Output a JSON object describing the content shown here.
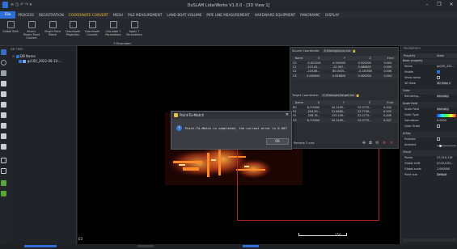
{
  "window": {
    "title": "DuSLAM LidarWorks V1.0.0 - [3D View 1]",
    "quick_access": "≡  ◫  ↶  ↷  ▾",
    "controls": [
      "–",
      "❐",
      "✕"
    ]
  },
  "menu": {
    "file": "File",
    "items": [
      "PROCESS",
      "REGISTRATION",
      "COORDINATE CONVERT",
      "MESH",
      "PILE MEASUREMENT",
      "LAND BOAT VOLUME",
      "PIPE LINE MEASUREMENT",
      "HARDWARE EQUIPMENT",
      "PANORAMIC",
      "DISPLAY"
    ],
    "active_index": 2
  },
  "ribbon": {
    "buttons": [
      {
        "label": "Global Shift",
        "icon": "global-shift-icon"
      },
      {
        "label": "Seven-Param Point Convert",
        "icon": "point-convert-icon"
      },
      {
        "label": "Single Point Match",
        "icon": "point-match-icon"
      },
      {
        "label": "Coordinate Projection",
        "icon": "projection-icon"
      },
      {
        "label": "Coordinate Convert",
        "icon": "coordinate-convert-icon"
      },
      {
        "label": "Calculate 7 Parameters",
        "icon": "calculate-icon"
      },
      {
        "label": "Apply 7 Parameters",
        "icon": "apply-icon"
      }
    ],
    "group_label": "7 Parameter"
  },
  "tree": {
    "header": "DB TREE",
    "rows": [
      {
        "label": "DB Name",
        "level": 0
      },
      {
        "label": "gs100_2022-08-10-...",
        "level": 1
      }
    ]
  },
  "source_panel": {
    "label": "Source Coordinate:",
    "path": "E:/Data/pts/src.txt",
    "columns": [
      "Name",
      "X",
      "Y",
      "Z",
      "Error"
    ],
    "rows": [
      [
        "C0",
        "-0.001000",
        "0.000000",
        "0.000000",
        "0.004"
      ],
      [
        "C1",
        "-213.42...",
        "-22.267...",
        "0.086835",
        "0.009"
      ],
      [
        "C2",
        "-216.86...",
        "80.0435...",
        "-0.130000",
        "0.006"
      ],
      [
        "C3",
        "0.000000",
        "0.616800",
        "0.000000",
        "0.004"
      ]
    ]
  },
  "target_panel": {
    "label": "Target Coordinate:",
    "path": "E:/Data/pts/target.txt",
    "columns": [
      "Name",
      "X",
      "Y",
      "Z",
      "Error"
    ],
    "rows": [
      [
        "R0",
        "6.1*5000",
        "54.1200...",
        "22.0770...",
        "0.004"
      ],
      [
        "R1",
        "-204.90...",
        "31.8480...",
        "22.7749...",
        "0.009"
      ],
      [
        "R2",
        "-208.35...",
        "125.109...",
        "22.0770...",
        "0.006"
      ],
      [
        "R3",
        "6.1*5000",
        "54.1200...",
        "22.0770...",
        "0.007"
      ]
    ]
  },
  "rmse_text": "Remote 2 vals",
  "panel_buttons": [
    "✣",
    "✿",
    "⟲",
    "⊗",
    "✕"
  ],
  "message_box": {
    "title": "Point-To-Match",
    "text": "Point-To-Match is completed, the current error is 0.007",
    "ok": "OK",
    "close": "✕",
    "icon": "i"
  },
  "properties": {
    "header": "PROPERTIES",
    "columns": [
      "Property",
      "State"
    ],
    "rows": [
      {
        "type": "section",
        "key": "Basic property"
      },
      {
        "type": "row",
        "key": "Name",
        "value": "gs100_202..."
      },
      {
        "type": "row",
        "key": "Visible",
        "check": true
      },
      {
        "type": "row",
        "key": "Show name",
        "check": false
      },
      {
        "type": "row",
        "key": "3D View",
        "value": "3D View 1"
      },
      {
        "type": "section",
        "key": "Color"
      },
      {
        "type": "row",
        "key": "Rendering...",
        "value": "Intensity"
      },
      {
        "type": "section",
        "key": "Scale Field"
      },
      {
        "type": "row",
        "key": "Scale Field",
        "value": "intensity"
      },
      {
        "type": "row",
        "key": "Color Type",
        "gradient": true
      },
      {
        "type": "row",
        "key": "Saturation",
        "value": "0.0000"
      },
      {
        "type": "row",
        "key": "Color Scale",
        "check": false
      },
      {
        "type": "section",
        "key": "X-Ray"
      },
      {
        "type": "row",
        "key": "Enabled",
        "check": false
      },
      {
        "type": "row",
        "key": "Ambient",
        "slider": 0.12
      },
      {
        "type": "section",
        "key": "Cloud"
      },
      {
        "type": "row",
        "key": "Points",
        "value": "27,510,116"
      },
      {
        "type": "row",
        "key": "Global shift",
        "value": "(0.00,0.00..."
      },
      {
        "type": "row",
        "key": "Global scale",
        "value": "1.000000"
      },
      {
        "type": "row",
        "key": "Point size",
        "value": "Default"
      }
    ]
  },
  "viewport": {
    "scale_label": "150",
    "view_index": "E3"
  }
}
